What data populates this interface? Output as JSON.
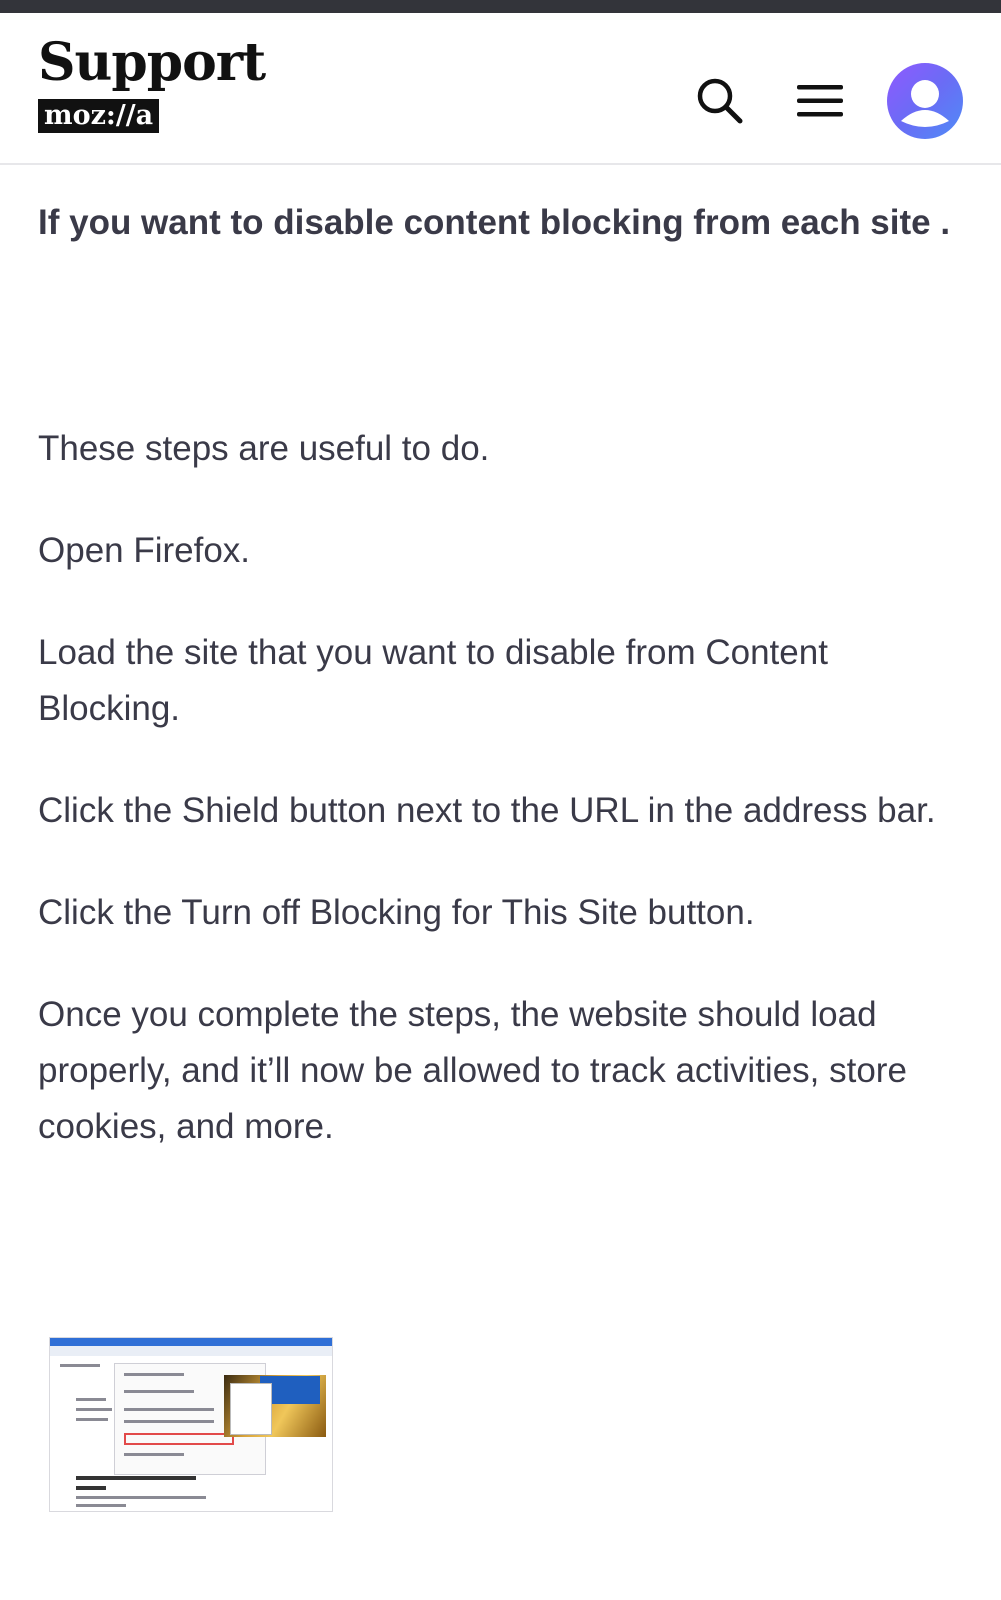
{
  "header": {
    "brand_title": "Support",
    "brand_wordmark": "moz://a",
    "icons": [
      "search-icon",
      "hamburger-menu-icon",
      "user-avatar-icon"
    ]
  },
  "article": {
    "lead": "If you want to disable content blocking from each site .",
    "paragraphs": [
      "These steps are useful to do.",
      "Open Firefox.",
      "Load the site that you want to disable from Content Blocking.",
      "Click the Shield button next to the URL in the address bar.",
      "Click the Turn off Blocking for This Site button.",
      "Once you complete the steps, the website should load properly, and it’ll now be allowed to track activities, store cookies, and more."
    ]
  },
  "colors": {
    "top_strip": "#33343a",
    "text": "#3a3a48",
    "avatar_gradient_start": "#9059ff",
    "avatar_gradient_end": "#4f8cf7"
  }
}
